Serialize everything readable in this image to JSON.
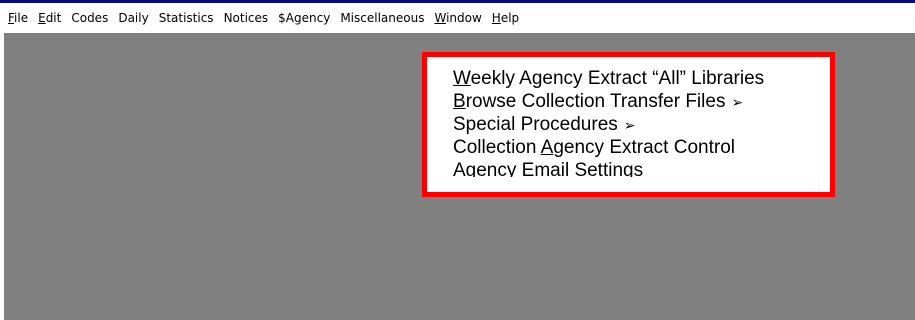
{
  "menubar": {
    "items": [
      {
        "first": "F",
        "rest": "ile"
      },
      {
        "first": "E",
        "rest": "dit"
      },
      {
        "first": "",
        "rest": "Codes"
      },
      {
        "first": "",
        "rest": "Daily"
      },
      {
        "first": "",
        "rest": "Statistics"
      },
      {
        "first": "",
        "rest": "Notices"
      },
      {
        "first": "",
        "rest": "$Agency"
      },
      {
        "first": "",
        "rest": "Miscellaneous"
      },
      {
        "first": "W",
        "rest": "indow"
      },
      {
        "first": "H",
        "rest": "elp"
      }
    ]
  },
  "submenu": {
    "items": [
      {
        "pre": "",
        "u": "W",
        "post": "eekly Agency Extract “All” Libraries",
        "arrow": ""
      },
      {
        "pre": "",
        "u": "B",
        "post": "rowse Collection Transfer Files",
        "arrow": "➢"
      },
      {
        "pre": "Special Procedures",
        "u": "",
        "post": "",
        "arrow": "➢"
      },
      {
        "pre": "Collection ",
        "u": "A",
        "post": "gency Extract Control",
        "arrow": ""
      },
      {
        "pre": "Agency Email Settings",
        "u": "",
        "post": "",
        "arrow": ""
      }
    ]
  },
  "colors": {
    "workspace": "#808080",
    "highlight_border": "#ff0000",
    "title_strip": "#0a0a7a"
  }
}
